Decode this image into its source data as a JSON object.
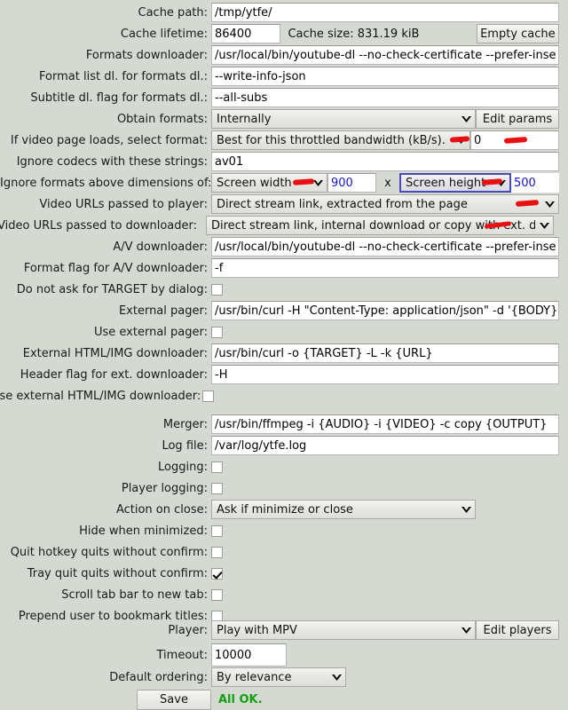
{
  "app": {
    "background_color": "#d4dad2",
    "accent_blue": "#1414c8",
    "status_color": "#10a010",
    "annotation_color": "#e81010"
  },
  "status": {
    "text": "All OK."
  },
  "buttons": {
    "empty_cache": "Empty cache",
    "edit_params": "Edit params",
    "edit_players": "Edit players",
    "save": "Save"
  },
  "icons": {
    "chevron_down": "chevron-down-icon",
    "checkmark": "checkmark-icon"
  },
  "rows": [
    {
      "label": "Cache path:",
      "type": "entry",
      "value": "/tmp/ytfe/"
    },
    {
      "label": "Cache lifetime:",
      "type": "entry_static_button",
      "value": "86400",
      "static": "Cache size: 831.19 kiB",
      "button": "Empty cache"
    },
    {
      "label": "Formats downloader:",
      "type": "entry",
      "value": "/usr/local/bin/youtube-dl --no-check-certificate --prefer-inse"
    },
    {
      "label": "Format list dl. for formats dl.:",
      "type": "entry",
      "value": "--write-info-json"
    },
    {
      "label": "Subtitle dl. flag for formats dl.:",
      "type": "entry",
      "value": "--all-subs"
    },
    {
      "label": "Obtain formats:",
      "type": "combo_button",
      "value": "Internally",
      "button": "Edit params"
    },
    {
      "label": "If video page loads, select format:",
      "type": "combo_entry",
      "value": "Best for this throttled bandwidth (kB/s).",
      "entry_value": "0"
    },
    {
      "label": "Ignore codecs with these strings:",
      "type": "entry",
      "value": "av01"
    },
    {
      "label": "Ignore formats above dimensions of:",
      "type": "dimensions",
      "width_label": "Screen width",
      "width_value": "900",
      "separator": "x",
      "height_label": "Screen height",
      "height_value": "500"
    },
    {
      "label": "Video URLs passed to player:",
      "type": "combo",
      "value": "Direct stream link, extracted from the page"
    },
    {
      "label": "Video URLs passed to downloader:",
      "type": "combo",
      "value": "Direct stream link, internal download or copy with ext. d"
    },
    {
      "label": "A/V downloader:",
      "type": "entry",
      "value": "/usr/local/bin/youtube-dl --no-check-certificate --prefer-inse"
    },
    {
      "label": "Format flag for A/V downloader:",
      "type": "entry",
      "value": "-f"
    },
    {
      "label": "Do not ask for TARGET by dialog:",
      "type": "check",
      "checked": false
    },
    {
      "label": "External pager:",
      "type": "entry",
      "value": "/usr/bin/curl -H \"Content-Type: application/json\" -d '{BODY}"
    },
    {
      "label": "Use external pager:",
      "type": "check",
      "checked": false
    },
    {
      "label": "External HTML/IMG downloader:",
      "type": "entry",
      "value": "/usr/bin/curl -o {TARGET} -L -k {URL}"
    },
    {
      "label": "Header flag for ext. downloader:",
      "type": "entry",
      "value": "-H"
    },
    {
      "label": "Use external HTML/IMG downloader:",
      "type": "check",
      "checked": false
    },
    {
      "label": "Merger:",
      "type": "entry",
      "value": "/usr/bin/ffmpeg -i {AUDIO} -i {VIDEO} -c copy {OUTPUT}"
    },
    {
      "label": "Log file:",
      "type": "entry",
      "value": "/var/log/ytfe.log"
    },
    {
      "label": "Logging:",
      "type": "check",
      "checked": false
    },
    {
      "label": "Player logging:",
      "type": "check",
      "checked": false
    },
    {
      "label": "Action on close:",
      "type": "combo",
      "value": "Ask if minimize or close"
    },
    {
      "label": "Hide when minimized:",
      "type": "check",
      "checked": false
    },
    {
      "label": "Quit hotkey quits without confirm:",
      "type": "check",
      "checked": false
    },
    {
      "label": "Tray quit quits without confirm:",
      "type": "check",
      "checked": true
    },
    {
      "label": "Scroll tab bar to new tab:",
      "type": "check",
      "checked": false
    },
    {
      "label": "Prepend user to bookmark titles:",
      "type": "check",
      "checked": false
    },
    {
      "label": "Player:",
      "type": "combo_button",
      "value": "Play with MPV",
      "button": "Edit players"
    },
    {
      "label": "Timeout:",
      "type": "entry",
      "value": "10000"
    },
    {
      "label": "Default ordering:",
      "type": "combo",
      "value": "By relevance"
    },
    {
      "label": "",
      "type": "save",
      "button": "Save",
      "status": "All OK."
    }
  ]
}
